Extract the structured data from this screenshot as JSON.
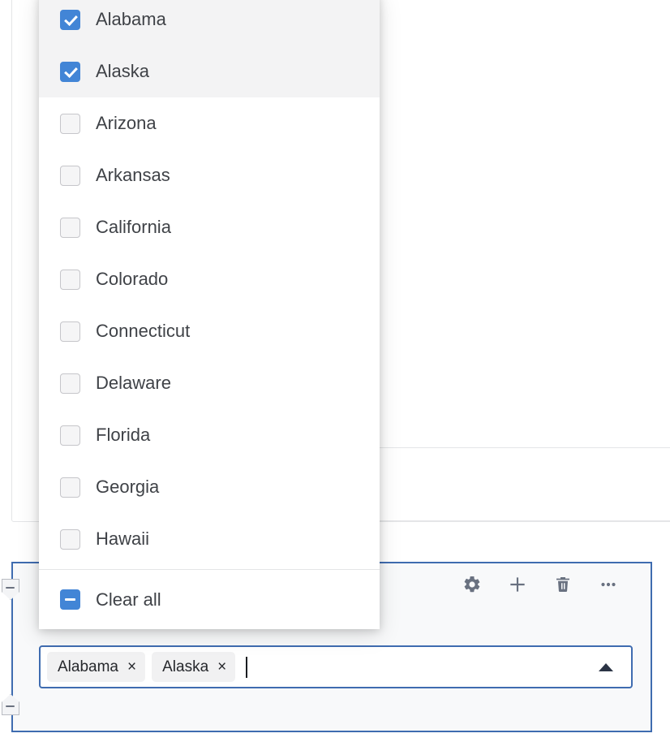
{
  "dropdown": {
    "options": [
      {
        "label": "Alabama",
        "checked": true
      },
      {
        "label": "Alaska",
        "checked": true
      },
      {
        "label": "Arizona",
        "checked": false
      },
      {
        "label": "Arkansas",
        "checked": false
      },
      {
        "label": "California",
        "checked": false
      },
      {
        "label": "Colorado",
        "checked": false
      },
      {
        "label": "Connecticut",
        "checked": false
      },
      {
        "label": "Delaware",
        "checked": false
      },
      {
        "label": "Florida",
        "checked": false
      },
      {
        "label": "Georgia",
        "checked": false
      },
      {
        "label": "Hawaii",
        "checked": false
      }
    ],
    "footer": {
      "label": "Clear all",
      "checkbox_state": "indeterminate"
    }
  },
  "multiselect": {
    "chips": [
      {
        "label": "Alabama",
        "remove_glyph": "×"
      },
      {
        "label": "Alaska",
        "remove_glyph": "×"
      }
    ],
    "typed_value": "",
    "placeholder": "",
    "toggle_icon": "caret-up-icon"
  },
  "toolbar": {
    "buttons": [
      {
        "name": "settings-button",
        "icon": "gear-icon",
        "label": "Settings"
      },
      {
        "name": "add-button",
        "icon": "plus-icon",
        "label": "Add"
      },
      {
        "name": "delete-button",
        "icon": "trash-icon",
        "label": "Delete"
      },
      {
        "name": "more-button",
        "icon": "ellipsis-icon",
        "label": "More"
      }
    ]
  },
  "panel": {
    "collapse_handles": [
      {
        "name": "collapse-handle-top",
        "icon": "minus-icon"
      },
      {
        "name": "collapse-handle-bottom",
        "icon": "minus-icon"
      }
    ]
  },
  "colors": {
    "accent_blue": "#4285d6",
    "panel_border_blue": "#3f6cb0",
    "text_primary": "#3f4247",
    "chip_bg": "#f1f1f2",
    "row_selected_bg": "#f3f3f4",
    "icon_gray": "#697180",
    "panel_bg": "#f8f9fa"
  }
}
